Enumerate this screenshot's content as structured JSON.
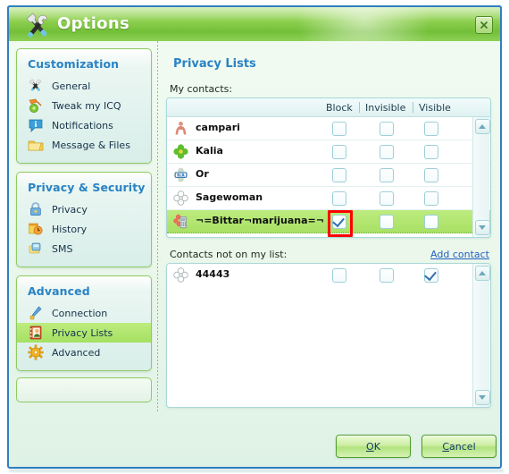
{
  "window": {
    "title": "Options",
    "title_icon": "tools-icon",
    "close_icon": "close-icon"
  },
  "sidebar": {
    "groups": [
      {
        "title": "Customization",
        "items": [
          {
            "label": "General",
            "icon": "tools-icon",
            "selected": false
          },
          {
            "label": "Tweak my ICQ",
            "icon": "paint-icon",
            "selected": false
          },
          {
            "label": "Notifications",
            "icon": "info-bubble-icon",
            "selected": false
          },
          {
            "label": "Message & Files",
            "icon": "folder-icon",
            "selected": false
          }
        ]
      },
      {
        "title": "Privacy & Security",
        "items": [
          {
            "label": "Privacy",
            "icon": "lock-icon",
            "selected": false
          },
          {
            "label": "History",
            "icon": "clock-icon",
            "selected": false
          },
          {
            "label": "SMS",
            "icon": "phone-icon",
            "selected": false
          }
        ]
      },
      {
        "title": "Advanced",
        "items": [
          {
            "label": "Connection",
            "icon": "plug-icon",
            "selected": false
          },
          {
            "label": "Privacy Lists",
            "icon": "contact-icon",
            "selected": true
          },
          {
            "label": "Advanced",
            "icon": "gear-icon",
            "selected": false
          }
        ]
      }
    ]
  },
  "main": {
    "page_title": "Privacy Lists",
    "my_contacts_label": "My contacts:",
    "not_on_list_label": "Contacts not on my list:",
    "add_contact_label": "Add contact",
    "columns": [
      "Block",
      "Invisible",
      "Visible"
    ],
    "my_contacts": [
      {
        "name": "campari",
        "icon": "person-red-icon",
        "block": false,
        "invisible": false,
        "visible": false,
        "selected": false
      },
      {
        "name": "Kalia",
        "icon": "flower-green-icon",
        "block": false,
        "invisible": false,
        "visible": false,
        "selected": false
      },
      {
        "name": "Or",
        "icon": "na-badge-icon",
        "block": false,
        "invisible": false,
        "visible": false,
        "selected": false
      },
      {
        "name": "Sagewoman",
        "icon": "flower-grey-icon",
        "block": false,
        "invisible": false,
        "visible": false,
        "selected": false
      },
      {
        "name": "¬=Bittar¬marijuana=¬",
        "icon": "mobile-flower-icon",
        "block": true,
        "invisible": false,
        "visible": false,
        "selected": true
      }
    ],
    "not_on_list": [
      {
        "name": "44443",
        "icon": "flower-grey-icon",
        "block": false,
        "invisible": false,
        "visible": true,
        "selected": false
      }
    ]
  },
  "footer": {
    "ok_key": "O",
    "ok_rest": "K",
    "cancel_key": "C",
    "cancel_rest": "ancel"
  },
  "colors": {
    "accent_green": "#8ccf4e",
    "title_blue": "#2a83c4",
    "selection_green": "#b3e76f",
    "highlight_red": "#ff0000",
    "border_blue": "#2f7fbf"
  }
}
